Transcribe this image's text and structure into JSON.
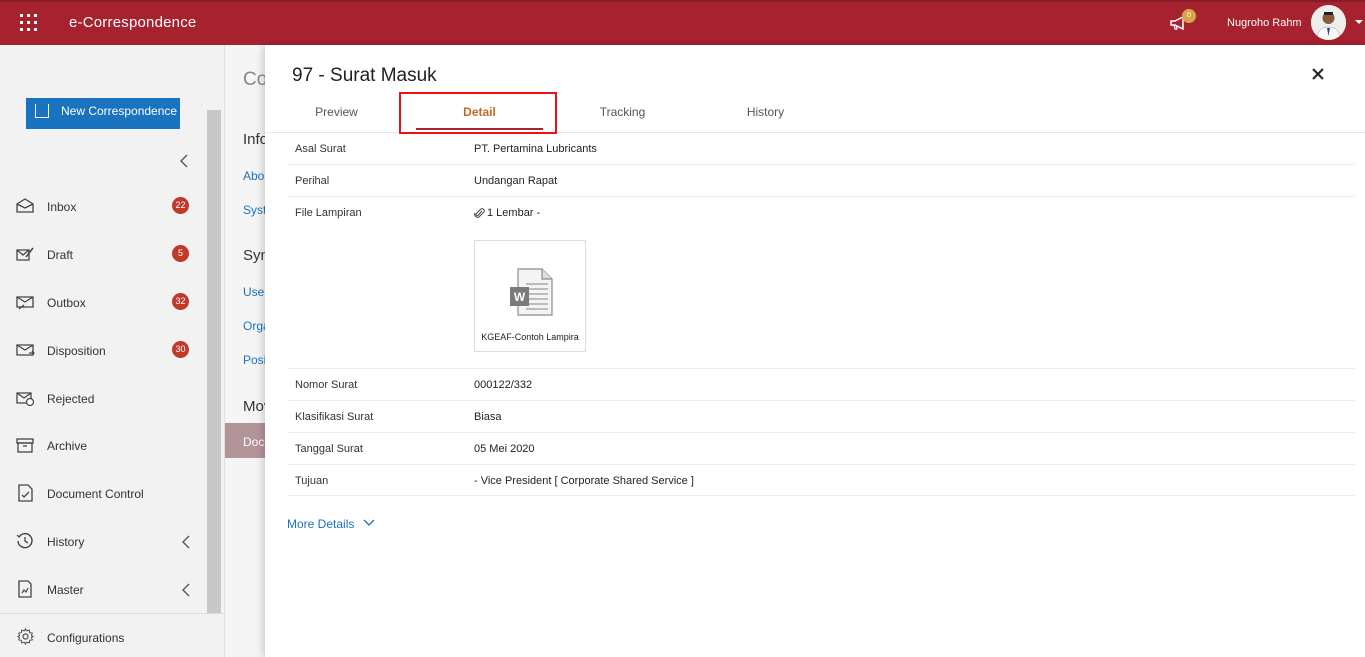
{
  "header": {
    "app_title": "e-Correspondence",
    "notification_count": "0",
    "user_name": "Nugroho Rahm"
  },
  "sidebar": {
    "new_button": "New Correspondence",
    "items": [
      {
        "label": "Inbox",
        "badge": "22",
        "icon": "inbox-icon"
      },
      {
        "label": "Draft",
        "badge": "5",
        "icon": "draft-icon"
      },
      {
        "label": "Outbox",
        "badge": "32",
        "icon": "outbox-icon"
      },
      {
        "label": "Disposition",
        "badge": "30",
        "icon": "disposition-icon"
      },
      {
        "label": "Rejected",
        "badge": "",
        "icon": "rejected-icon"
      },
      {
        "label": "Archive",
        "badge": "",
        "icon": "archive-icon"
      },
      {
        "label": "Document Control",
        "badge": "",
        "icon": "document-control-icon"
      },
      {
        "label": "History",
        "badge": "",
        "icon": "history-icon"
      },
      {
        "label": "Master",
        "badge": "",
        "icon": "master-icon"
      }
    ],
    "config_label": "Configurations"
  },
  "background_page": {
    "title": "Co",
    "section1": "Info",
    "link1": "Abou",
    "link2": "Syst",
    "section2": "Sync",
    "link3": "User",
    "link4": "Orga",
    "link5": "Posi",
    "section3": "Mov",
    "active_item": "Docu"
  },
  "panel": {
    "title": "97 - Surat Masuk",
    "tabs": [
      "Preview",
      "Detail",
      "Tracking",
      "History"
    ],
    "active_tab": "Detail",
    "fields": [
      {
        "label": "Asal Surat",
        "value": "PT. Pertamina Lubricants"
      },
      {
        "label": "Perihal",
        "value": "Undangan Rapat"
      },
      {
        "label": "File Lampiran",
        "value": "1 Lembar -"
      },
      {
        "label": "Nomor Surat",
        "value": "000122/332"
      },
      {
        "label": "Klasifikasi Surat",
        "value": "Biasa"
      },
      {
        "label": "Tanggal Surat",
        "value": "05 Mei 2020"
      },
      {
        "label": "Tujuan",
        "value": "- Vice President [ Corporate Shared Service ]"
      }
    ],
    "attachment_name": "KGEAF-Contoh Lampira",
    "more_details": "More Details"
  },
  "colors": {
    "brand": "#a6222e",
    "link": "#1a73be",
    "active_tab": "#c06a25",
    "badge": "#c0392b",
    "highlight": "#ee1111"
  }
}
